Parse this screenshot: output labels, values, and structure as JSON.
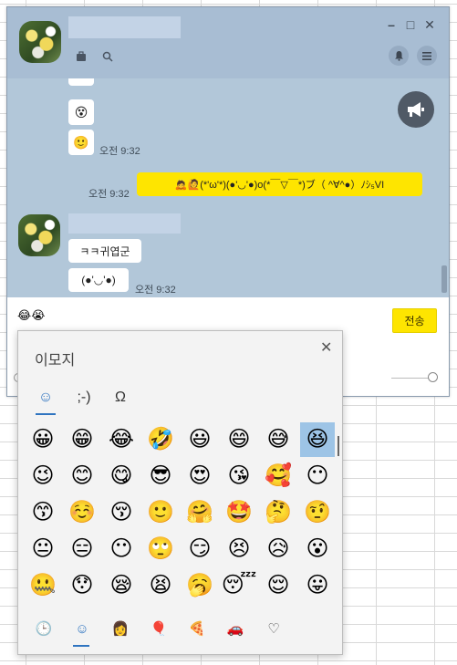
{
  "header": {
    "icons": [
      "toolbox-icon",
      "search-icon"
    ],
    "right_icons": [
      "bell-icon",
      "menu-icon"
    ],
    "window_controls": {
      "minimize": "–",
      "maximize": "□",
      "close": "✕"
    }
  },
  "messages": {
    "sent_emoticon_1": "😑",
    "sent_emoticon_2": "😵",
    "sent_emoticon_3": "🙂",
    "sent_time_1": "오전 9:32",
    "outgoing_time": "오전 9:32",
    "outgoing_text": "🙇🙋(*'ω'*)(●'◡'●)o(*￣▽￣*)ブ（ ^∀^●）ﾉｼ₅VI",
    "reply_1": "ㅋㅋ귀엽군",
    "reply_2": "(●'◡'●)",
    "reply_time": "오전 9:32"
  },
  "input": {
    "value": "😂😭",
    "send_label": "전송"
  },
  "emoji_panel": {
    "title": "이모지",
    "close_glyph": "✕",
    "categories": [
      "☺",
      ";-)",
      "Ω"
    ],
    "emojis": [
      [
        "😀",
        "😁",
        "😂",
        "🤣",
        "😃",
        "😄",
        "😅",
        "😆"
      ],
      [
        "😉",
        "😊",
        "😋",
        "😎",
        "😍",
        "😘",
        "🥰",
        "😶"
      ],
      [
        "😙",
        "☺️",
        "😚",
        "🙂",
        "🤗",
        "🤩",
        "🤔",
        "🤨"
      ],
      [
        "😐",
        "😑",
        "😶",
        "🙄",
        "😏",
        "😣",
        "😥",
        "😮"
      ],
      [
        "🤐",
        "😯",
        "😪",
        "😫",
        "🥱",
        "😴",
        "😌",
        "😛"
      ]
    ],
    "bottom_tabs": [
      "🕒",
      "☺",
      "👩",
      "🎈",
      "🍕",
      "🚗",
      "♡"
    ]
  }
}
